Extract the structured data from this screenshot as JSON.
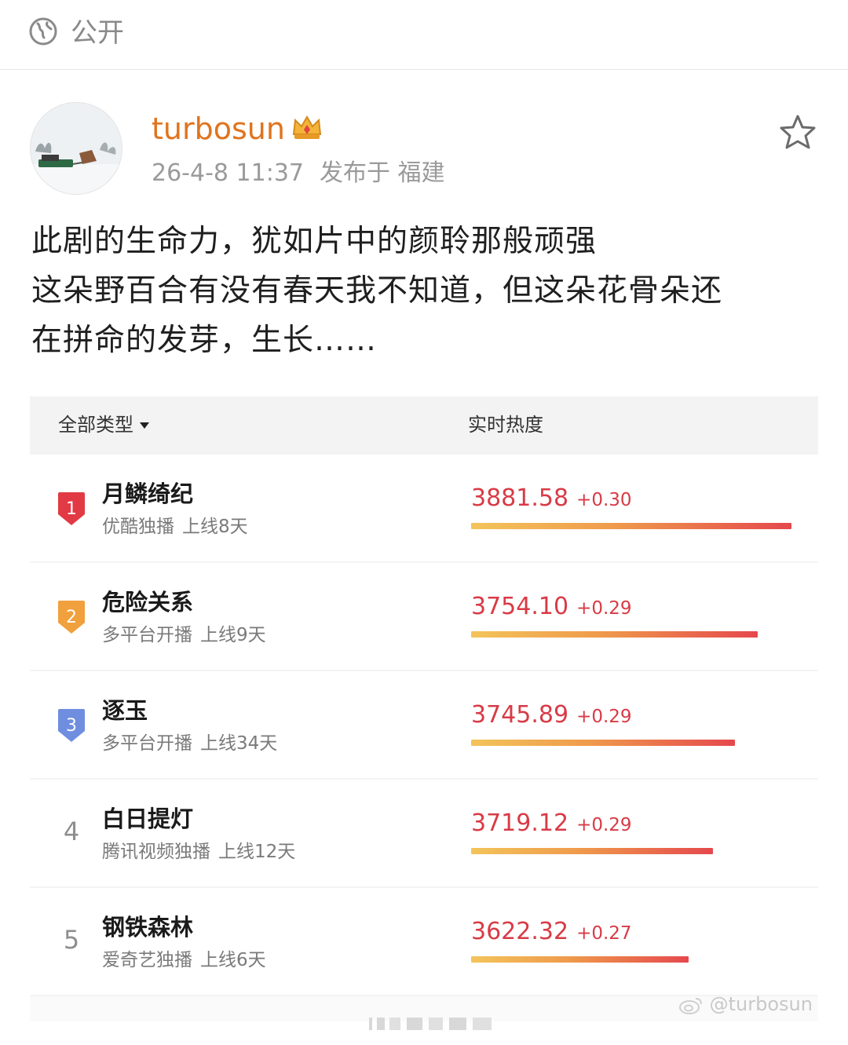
{
  "visibility": {
    "label": "公开",
    "icon": "globe-icon"
  },
  "post": {
    "author": "turbosun",
    "time": "26-4-8 11:37",
    "location": "发布于 福建",
    "text_lines": [
      "此剧的生命力，犹如片中的颜聆那般顽强",
      "这朵野百合有没有春天我不知道，但这朵花骨朵还",
      "在拼命的发芽，生长……"
    ]
  },
  "ranking": {
    "filter_label": "全部类型",
    "hot_label": "实时热度",
    "colors": {
      "bar_start": "#f3c45a",
      "bar_end": "#e5484d",
      "score": "#d83b46",
      "rank1": "#e23a44",
      "rank2": "#f0a03c",
      "rank3": "#6f8ee0"
    },
    "items": [
      {
        "rank": "1",
        "title": "月鳞绮纪",
        "platform": "优酷独播",
        "online": "上线8天",
        "score": "3881.58",
        "delta": "+0.30",
        "level": 1.0
      },
      {
        "rank": "2",
        "title": "危险关系",
        "platform": "多平台开播",
        "online": "上线9天",
        "score": "3754.10",
        "delta": "+0.29",
        "level": 0.895
      },
      {
        "rank": "3",
        "title": "逐玉",
        "platform": "多平台开播",
        "online": "上线34天",
        "score": "3745.89",
        "delta": "+0.29",
        "level": 0.824
      },
      {
        "rank": "4",
        "title": "白日提灯",
        "platform": "腾讯视频独播",
        "online": "上线12天",
        "score": "3719.12",
        "delta": "+0.29",
        "level": 0.755
      },
      {
        "rank": "5",
        "title": "钢铁森林",
        "platform": "爱奇艺独播",
        "online": "上线6天",
        "score": "3622.32",
        "delta": "+0.27",
        "level": 0.679
      }
    ]
  },
  "watermark": "@turbosun"
}
